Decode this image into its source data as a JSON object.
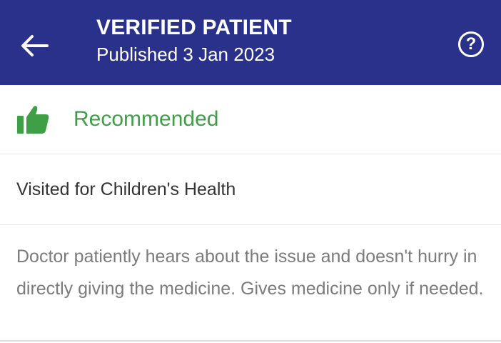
{
  "header": {
    "title": "VERIFIED PATIENT",
    "published": "Published 3 Jan 2023",
    "back_icon": "arrow-left-icon",
    "help_icon": "question-circle-icon",
    "background_color": "#29318b"
  },
  "recommendation": {
    "label": "Recommended",
    "icon": "thumbs-up-icon",
    "color": "#3e9f47"
  },
  "visit": {
    "label": "Visited for Children's Health"
  },
  "review": {
    "text": "Doctor patiently hears about the issue and doesn't hurry in directly giving the medicine. Gives medicine only if needed."
  }
}
